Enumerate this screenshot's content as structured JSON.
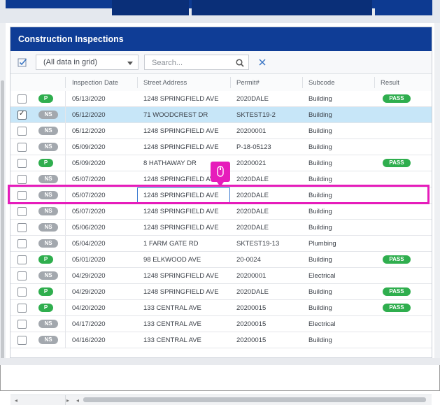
{
  "panel": {
    "title": "Construction Inspections"
  },
  "toolbar": {
    "dropdown_value": "(All data in grid)",
    "search_placeholder": "Search..."
  },
  "columns": {
    "date": "Inspection Date",
    "address": "Street Address",
    "permit": "Permit#",
    "subcode": "Subcode",
    "result": "Result"
  },
  "rows": [
    {
      "status": "P",
      "date": "05/13/2020",
      "address": "1248 SPRINGFIELD AVE",
      "permit": "2020DALE",
      "subcode": "Building",
      "result": "PASS",
      "checked": false
    },
    {
      "status": "NS",
      "date": "05/12/2020",
      "address": "71 WOODCREST DR",
      "permit": "SKTEST19-2",
      "subcode": "Building",
      "result": "",
      "checked": true
    },
    {
      "status": "NS",
      "date": "05/12/2020",
      "address": "1248 SPRINGFIELD AVE",
      "permit": "20200001",
      "subcode": "Building",
      "result": "",
      "checked": false
    },
    {
      "status": "NS",
      "date": "05/09/2020",
      "address": "1248 SPRINGFIELD AVE",
      "permit": "P-18-05123",
      "subcode": "Building",
      "result": "",
      "checked": false
    },
    {
      "status": "P",
      "date": "05/09/2020",
      "address": "8 HATHAWAY DR",
      "permit": "20200021",
      "subcode": "Building",
      "result": "PASS",
      "checked": false
    },
    {
      "status": "NS",
      "date": "05/07/2020",
      "address": "1248 SPRINGFIELD AVE",
      "permit": "2020DALE",
      "subcode": "Building",
      "result": "",
      "checked": false
    },
    {
      "status": "NS",
      "date": "05/07/2020",
      "address": "1248 SPRINGFIELD AVE",
      "permit": "2020DALE",
      "subcode": "Building",
      "result": "",
      "checked": false
    },
    {
      "status": "NS",
      "date": "05/07/2020",
      "address": "1248 SPRINGFIELD AVE",
      "permit": "2020DALE",
      "subcode": "Building",
      "result": "",
      "checked": false
    },
    {
      "status": "NS",
      "date": "05/06/2020",
      "address": "1248 SPRINGFIELD AVE",
      "permit": "2020DALE",
      "subcode": "Building",
      "result": "",
      "checked": false
    },
    {
      "status": "NS",
      "date": "05/04/2020",
      "address": "1 FARM GATE RD",
      "permit": "SKTEST19-13",
      "subcode": "Plumbing",
      "result": "",
      "checked": false
    },
    {
      "status": "P",
      "date": "05/01/2020",
      "address": "98 ELKWOOD AVE",
      "permit": "20-0024",
      "subcode": "Building",
      "result": "PASS",
      "checked": false
    },
    {
      "status": "NS",
      "date": "04/29/2020",
      "address": "1248 SPRINGFIELD AVE",
      "permit": "20200001",
      "subcode": "Electrical",
      "result": "",
      "checked": false
    },
    {
      "status": "P",
      "date": "04/29/2020",
      "address": "1248 SPRINGFIELD AVE",
      "permit": "2020DALE",
      "subcode": "Building",
      "result": "PASS",
      "checked": false
    },
    {
      "status": "P",
      "date": "04/20/2020",
      "address": "133 CENTRAL AVE",
      "permit": "20200015",
      "subcode": "Building",
      "result": "PASS",
      "checked": false
    },
    {
      "status": "NS",
      "date": "04/17/2020",
      "address": "133 CENTRAL AVE",
      "permit": "20200015",
      "subcode": "Electrical",
      "result": "",
      "checked": false
    },
    {
      "status": "NS",
      "date": "04/16/2020",
      "address": "133 CENTRAL AVE",
      "permit": "20200015",
      "subcode": "Building",
      "result": "",
      "checked": false
    }
  ],
  "colors": {
    "header_blue": "#0f3d96",
    "pass_green": "#2fae4e",
    "ns_gray": "#a3a8ae",
    "selected_row": "#c7e6f8",
    "highlight_magenta": "#e61cbb"
  }
}
